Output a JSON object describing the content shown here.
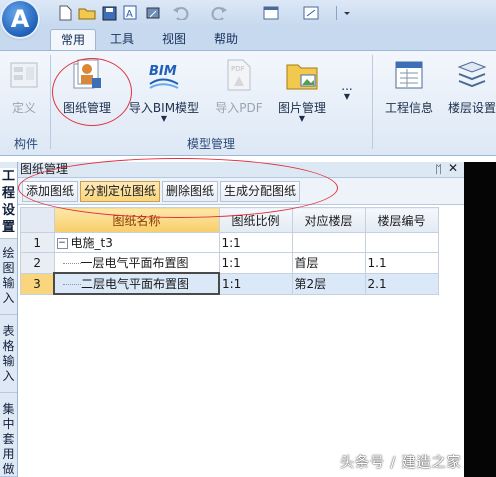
{
  "app": {
    "logo_letter": "A"
  },
  "tabs": [
    "常用",
    "工具",
    "视图",
    "帮助"
  ],
  "ribbon": {
    "buttons": [
      {
        "label": "定义",
        "disabled": true,
        "icon": "define-icon"
      },
      {
        "label": "图纸管理",
        "disabled": false,
        "icon": "drawing-manage-icon"
      },
      {
        "label": "导入BIM模型",
        "disabled": false,
        "icon": "bim-icon",
        "icon_text": "BIM"
      },
      {
        "label": "导入PDF",
        "disabled": true,
        "icon": "pdf-icon",
        "icon_text": "PDF"
      },
      {
        "label": "图片管理",
        "disabled": false,
        "icon": "picture-folder-icon"
      },
      {
        "label": "...",
        "disabled": false,
        "icon": "more-icon"
      },
      {
        "label": "工程信息",
        "disabled": false,
        "icon": "project-info-icon"
      },
      {
        "label": "楼层设置",
        "disabled": false,
        "icon": "floor-settings-icon"
      }
    ],
    "groups": [
      "构件",
      "模型管理"
    ]
  },
  "vtabs": [
    "工程设置",
    "绘图输入",
    "表格输入",
    "集中套用做"
  ],
  "pane": {
    "title": "图纸管理",
    "pin_glyph": "ᛖ",
    "close_glyph": "✕",
    "toolbar": [
      "添加图纸",
      "分割定位图纸",
      "删除图纸",
      "生成分配图纸"
    ]
  },
  "grid": {
    "headers": [
      "图纸名称",
      "图纸比例",
      "对应楼层",
      "楼层编号"
    ],
    "rows": [
      {
        "no": "1",
        "name": "电施_t3",
        "scale": "1:1",
        "floor": "",
        "floor_no": "",
        "expander": "−"
      },
      {
        "no": "2",
        "name": "一层电气平面布置图",
        "scale": "1:1",
        "floor": "首层",
        "floor_no": "1.1"
      },
      {
        "no": "3",
        "name": "二层电气平面布置图",
        "scale": "1:1",
        "floor": "第2层",
        "floor_no": "2.1"
      }
    ]
  },
  "watermark": "头条号 / 建造之家",
  "colors": {
    "annotation": "#e0333f",
    "ribbon_bg": "#dde8f5",
    "selected_row": "#f9d57e"
  }
}
